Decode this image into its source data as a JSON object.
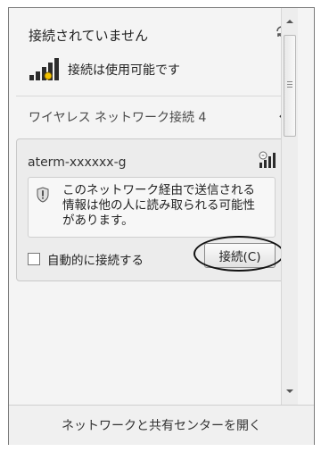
{
  "status": {
    "text": "接続されていません"
  },
  "availability": {
    "text": "接続は使用可能です"
  },
  "section": {
    "title": "ワイヤレス ネットワーク接続 4"
  },
  "network": {
    "ssid": "aterm-xxxxxx-g",
    "warning_lines": [
      "このネットワーク経由で送信される",
      "情報は他の人に読み取られる可能性",
      "があります。"
    ],
    "auto_connect_label": "自動的に接続する",
    "auto_connect_checked": false,
    "connect_label": "接続(C)"
  },
  "footer": {
    "link": "ネットワークと共有センターを開く"
  },
  "icons": {
    "refresh": "refresh-icon",
    "signal": "signal-bars-icon",
    "wifi_signal": "wifi-signal-icon",
    "shield": "shield-warning-icon",
    "collapse": "chevron-up-icon"
  }
}
